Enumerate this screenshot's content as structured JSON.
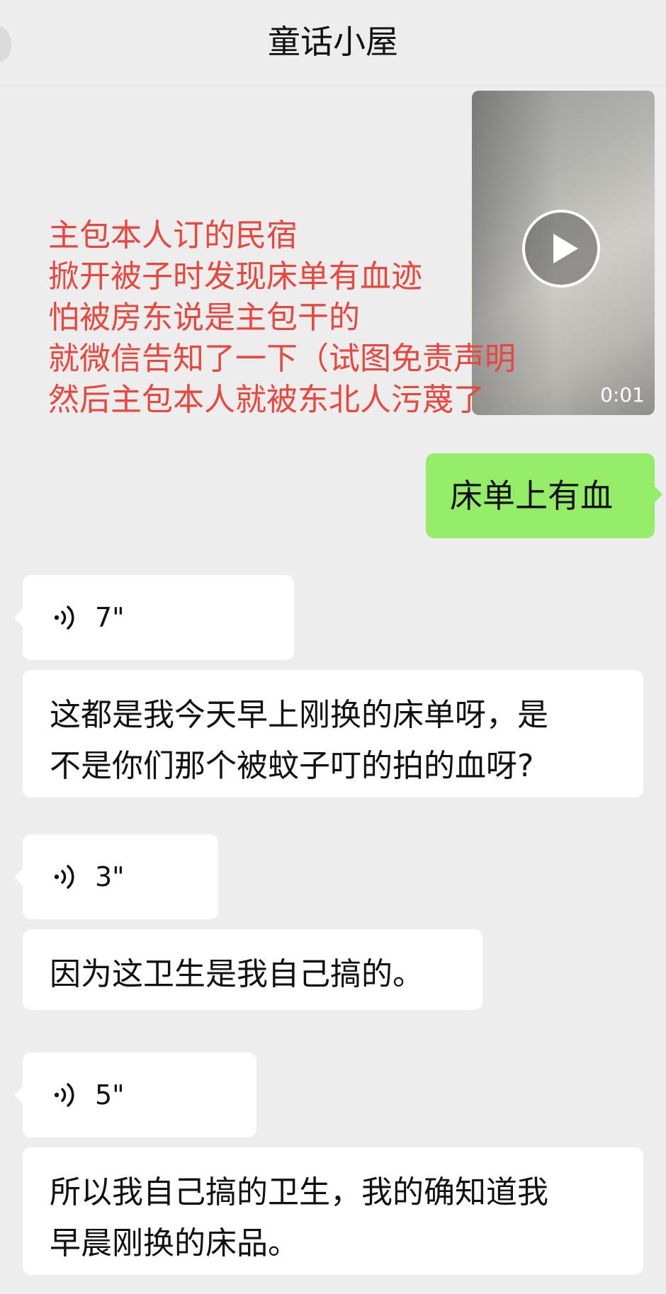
{
  "header": {
    "title": "童话小屋"
  },
  "video": {
    "duration": "0:01"
  },
  "overlay": {
    "color": "#e8473e",
    "lines": [
      "主包本人订的民宿",
      "掀开被子时发现床单有血迹",
      "怕被房东说是主包干的",
      "就微信告知了一下（试图免责声明",
      "然后主包本人就被东北人污蔑了"
    ]
  },
  "messages": {
    "sent_text": "床单上有血",
    "voice1": "7\"",
    "text1": [
      "这都是我今天早上刚换的床单呀，是",
      "不是你们那个被蚊子叮的拍的血呀?"
    ],
    "voice2": "3\"",
    "text2": [
      "因为这卫生是我自己搞的。"
    ],
    "voice3": "5\"",
    "text3": [
      "所以我自己搞的卫生，我的确知道我",
      "早晨刚换的床品。"
    ]
  },
  "colors": {
    "sent_bubble": "#95ec69",
    "received_bubble": "#ffffff",
    "background": "#ededed"
  },
  "icons": {
    "voice": "voice-wave-icon",
    "play": "play-icon",
    "back": "back-icon"
  }
}
